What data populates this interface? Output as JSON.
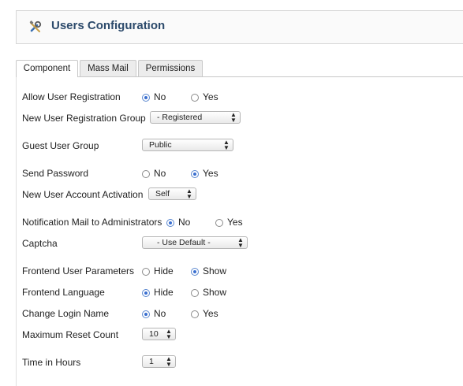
{
  "header": {
    "title": "Users Configuration",
    "icon": "tools-icon"
  },
  "tabs": [
    "Component",
    "Mass Mail",
    "Permissions"
  ],
  "fields": {
    "allow_registration": {
      "label": "Allow User Registration",
      "options": [
        "No",
        "Yes"
      ],
      "selected": "No"
    },
    "registration_group": {
      "label": "New User Registration Group",
      "value": "- Registered"
    },
    "guest_group": {
      "label": "Guest User Group",
      "value": "Public"
    },
    "send_password": {
      "label": "Send Password",
      "options": [
        "No",
        "Yes"
      ],
      "selected": "Yes"
    },
    "account_activation": {
      "label": "New User Account Activation",
      "value": "Self"
    },
    "notification_mail": {
      "label": "Notification Mail to Administrators",
      "options": [
        "No",
        "Yes"
      ],
      "selected": "No"
    },
    "captcha": {
      "label": "Captcha",
      "value": "- Use Default -"
    },
    "frontend_params": {
      "label": "Frontend User Parameters",
      "options": [
        "Hide",
        "Show"
      ],
      "selected": "Show"
    },
    "frontend_language": {
      "label": "Frontend Language",
      "options": [
        "Hide",
        "Show"
      ],
      "selected": "Hide"
    },
    "change_login": {
      "label": "Change Login Name",
      "options": [
        "No",
        "Yes"
      ],
      "selected": "No"
    },
    "max_reset": {
      "label": "Maximum Reset Count",
      "value": "10"
    },
    "time_hours": {
      "label": "Time in Hours",
      "value": "1"
    }
  },
  "colors": {
    "title": "#2c4a6b",
    "radio_selected": "#3a6fd0"
  }
}
